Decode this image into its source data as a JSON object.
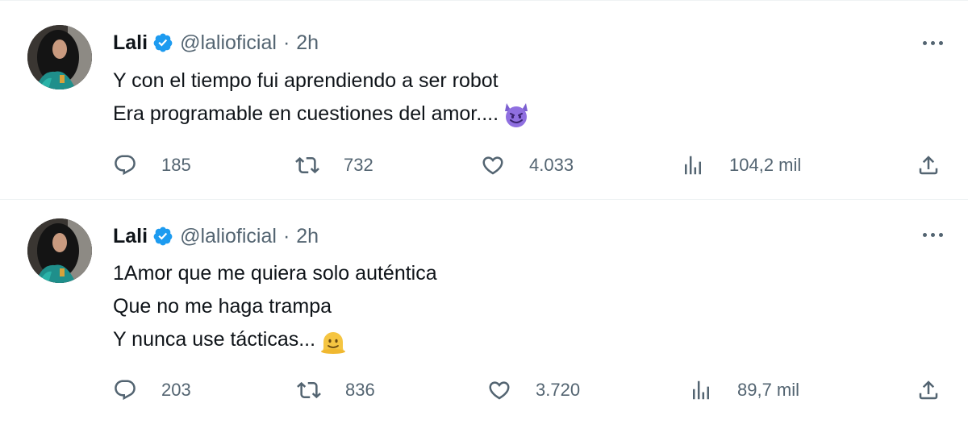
{
  "tweets": [
    {
      "name": "Lali",
      "handle": "@lalioficial",
      "separator": "·",
      "time": "2h",
      "lines": [
        "Y con el tiempo fui aprendiendo a ser robot",
        "Era programable en cuestiones del amor...."
      ],
      "emoji": "smiling-face-with-horns",
      "counts": {
        "replies": "185",
        "retweets": "732",
        "likes": "4.033",
        "views": "104,2 mil"
      }
    },
    {
      "name": "Lali",
      "handle": "@lalioficial",
      "separator": "·",
      "time": "2h",
      "lines": [
        "1Amor que me quiera solo auténtica",
        "Que no me haga trampa",
        "Y nunca use tácticas..."
      ],
      "emoji": "melting-face",
      "counts": {
        "replies": "203",
        "retweets": "836",
        "likes": "3.720",
        "views": "89,7 mil"
      }
    }
  ],
  "colors": {
    "text": "#0f1419",
    "secondary": "#536471",
    "verified": "#1d9bf0",
    "divider": "#eff3f4"
  }
}
